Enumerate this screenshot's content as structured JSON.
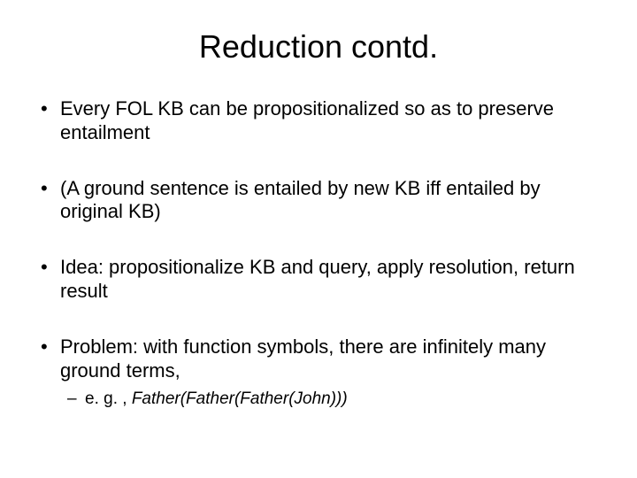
{
  "title": "Reduction contd.",
  "bullets": [
    {
      "text": "Every FOL KB can be propositionalized so as to preserve entailment"
    },
    {
      "text": "(A ground sentence is entailed by new KB iff entailed by original KB)"
    },
    {
      "text": "Idea: propositionalize KB and query, apply resolution, return result"
    },
    {
      "text": "Problem: with function symbols, there are infinitely many ground terms,"
    }
  ],
  "sub": {
    "prefix": "e. g. , ",
    "ital": "Father(Father(Father(John)))"
  }
}
